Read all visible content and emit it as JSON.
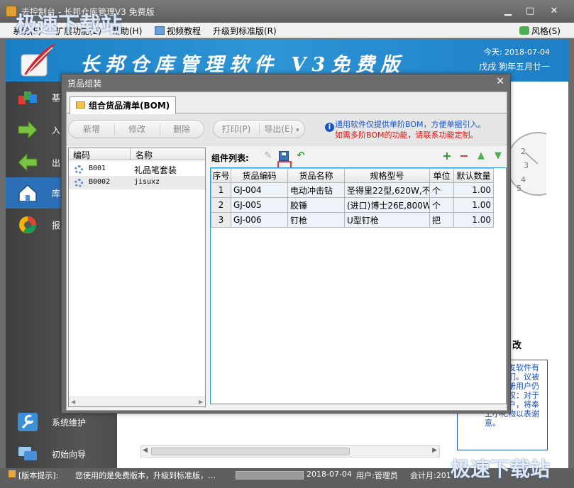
{
  "window": {
    "title": "去控制台 - 长邦仓库管理V3 免费版"
  },
  "menu": {
    "items": [
      "系统(F)",
      "扩展功能(E)",
      "帮助(H)",
      "视频教程",
      "升级到标准版(R)"
    ],
    "style_label": "风格(S)"
  },
  "banner": {
    "brand": "长邦仓库管理软件 V3免费版",
    "date_label": "今天: 2018-07-04",
    "lunar": "戊戌 狗年五月廿一"
  },
  "nav": {
    "items": [
      "基",
      "入",
      "出",
      "库",
      "报"
    ],
    "bottom": [
      "系统维护",
      "初始向导"
    ]
  },
  "dialog": {
    "title": "货品组装",
    "tab": "组合货品清单(BOM)",
    "buttons": {
      "add": "新增",
      "edit": "修改",
      "delete": "删除",
      "print": "打印(P)",
      "export": "导出(E)"
    },
    "info1": "通用软件仅提供单阶BOM，方便单据引入。",
    "info2": "如需多阶BOM的功能，请联系功能定制。",
    "bom_headers": [
      "编码",
      "名称"
    ],
    "bom_rows": [
      {
        "code": "B001",
        "name": "礼品笔套装"
      },
      {
        "code": "B0002",
        "name": "jisuxz"
      }
    ],
    "components_label": "组件列表:",
    "table_headers": [
      "序号",
      "货品编码",
      "货品名称",
      "规格型号",
      "单位",
      "默认数量"
    ],
    "table_rows": [
      [
        "1",
        "GJ-004",
        "电动冲击钻",
        "圣得里22型,620W,不",
        "个",
        "1.00"
      ],
      [
        "2",
        "GJ-005",
        "胶锤",
        "(进口)博士26E,800W",
        "个",
        "1.00"
      ],
      [
        "3",
        "GJ-006",
        "钉枪",
        "U型钉枪",
        "把",
        "1.00"
      ]
    ]
  },
  "workspace": {
    "notice_title": "改",
    "notice_text": "使用中发软件有好系我们。议被首先注册用户仍正式授权：对于注册用户，将奉上小礼物以表谢意。"
  },
  "status": {
    "hint": "[版本提示]:",
    "message": "您使用的是免费版本，升级到标准版，…",
    "date": "2018-07-04",
    "user": "用户:管理员",
    "period": "会计月:201"
  },
  "watermark": {
    "top": "极速下载站",
    "bottom": "极速下载站"
  },
  "colors": {
    "accent": "#1a7ec4",
    "highlight": "#e23b3b",
    "info_blue": "#1a55c8",
    "info_red": "#e01010"
  }
}
